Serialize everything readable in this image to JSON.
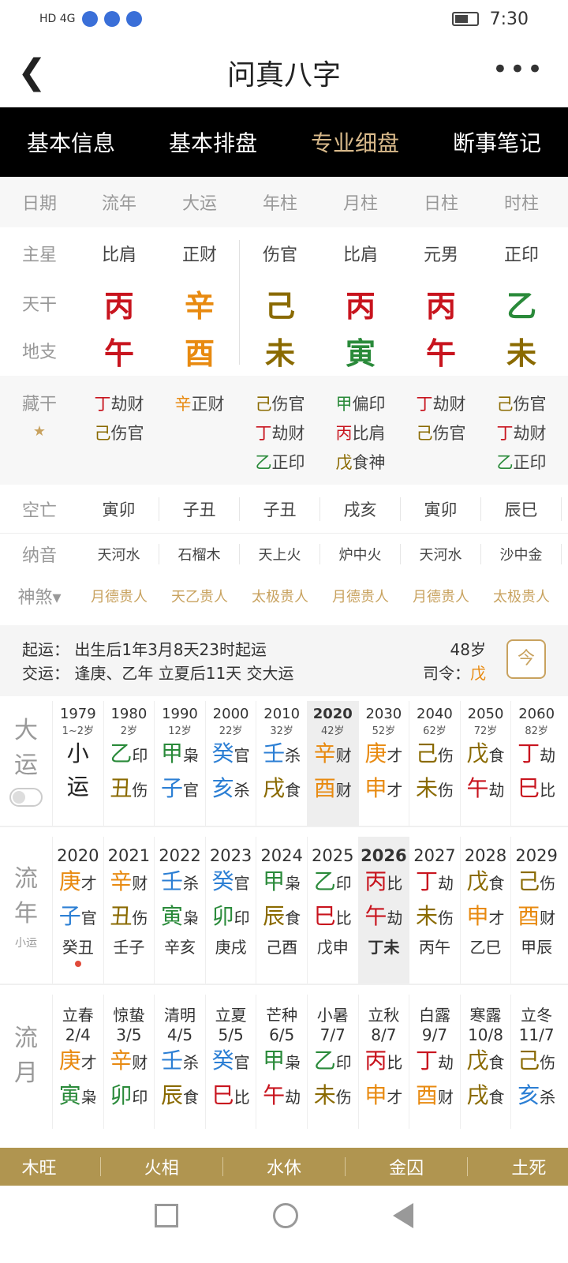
{
  "status": {
    "sig": "HD 4G",
    "time": "7:30"
  },
  "title": "问真八字",
  "tabs": [
    "基本信息",
    "基本排盘",
    "专业细盘",
    "断事笔记"
  ],
  "header": [
    "日期",
    "流年",
    "大运",
    "年柱",
    "月柱",
    "日柱",
    "时柱"
  ],
  "labels": {
    "zhuxing": "主星",
    "tiangan": "天干",
    "dizhi": "地支",
    "canggan": "藏干",
    "kongwang": "空亡",
    "nayin": "纳音",
    "shensha": "神煞"
  },
  "pillars": [
    {
      "star": "比肩",
      "gan": "丙",
      "zhi": "午",
      "gc": "red",
      "zc": "red"
    },
    {
      "star": "正财",
      "gan": "辛",
      "zhi": "酉",
      "gc": "org",
      "zc": "org"
    },
    {
      "star": "伤官",
      "gan": "己",
      "zhi": "未",
      "gc": "olv",
      "zc": "olv"
    },
    {
      "star": "比肩",
      "gan": "丙",
      "zhi": "寅",
      "gc": "red",
      "zc": "grn"
    },
    {
      "star": "元男",
      "gan": "丙",
      "zhi": "午",
      "gc": "red",
      "zc": "red"
    },
    {
      "star": "正印",
      "gan": "乙",
      "zhi": "未",
      "gc": "grn",
      "zc": "olv"
    }
  ],
  "canggan": [
    [
      "丁劫财",
      "己伤官"
    ],
    [
      "辛正财"
    ],
    [
      "己伤官",
      "丁劫财",
      "乙正印"
    ],
    [
      "甲偏印",
      "丙比肩",
      "戊食神"
    ],
    [
      "丁劫财",
      "己伤官"
    ],
    [
      "己伤官",
      "丁劫财",
      "乙正印"
    ]
  ],
  "kongwang": [
    "寅卯",
    "子丑",
    "子丑",
    "戌亥",
    "寅卯",
    "辰巳"
  ],
  "nayin": [
    "天河水",
    "石榴木",
    "天上火",
    "炉中火",
    "天河水",
    "沙中金"
  ],
  "shensha": [
    "月德贵人",
    "天乙贵人",
    "太极贵人",
    "月德贵人",
    "月德贵人",
    "太极贵人"
  ],
  "qiyun": {
    "line1": "起运： 出生后1年3月8天23时起运",
    "line2": "交运： 逢庚、乙年 立夏后11天 交大运",
    "age": "48岁",
    "siling": "司令：",
    "siling_val": "戊",
    "cal": "今"
  },
  "dayun": {
    "label1": "大",
    "label2": "运",
    "cols": [
      {
        "y": "1979",
        "a": "1~2岁",
        "g1": "小",
        "g2": "运"
      },
      {
        "y": "1980",
        "a": "2岁",
        "g1": "乙",
        "s1": "印",
        "g2": "丑",
        "s2": "伤"
      },
      {
        "y": "1990",
        "a": "12岁",
        "g1": "甲",
        "s1": "枭",
        "g2": "子",
        "s2": "官"
      },
      {
        "y": "2000",
        "a": "22岁",
        "g1": "癸",
        "s1": "官",
        "g2": "亥",
        "s2": "杀"
      },
      {
        "y": "2010",
        "a": "32岁",
        "g1": "壬",
        "s1": "杀",
        "g2": "戌",
        "s2": "食"
      },
      {
        "y": "2020",
        "a": "42岁",
        "g1": "辛",
        "s1": "财",
        "g2": "酉",
        "s2": "财"
      },
      {
        "y": "2030",
        "a": "52岁",
        "g1": "庚",
        "s1": "才",
        "g2": "申",
        "s2": "才"
      },
      {
        "y": "2040",
        "a": "62岁",
        "g1": "己",
        "s1": "伤",
        "g2": "未",
        "s2": "伤"
      },
      {
        "y": "2050",
        "a": "72岁",
        "g1": "戊",
        "s1": "食",
        "g2": "午",
        "s2": "劫"
      },
      {
        "y": "2060",
        "a": "82岁",
        "g1": "丁",
        "s1": "劫",
        "g2": "巳",
        "s2": "比"
      }
    ]
  },
  "liunian": {
    "label1": "流",
    "label2": "年",
    "small": "小运",
    "cols": [
      {
        "y": "2020",
        "g1": "庚",
        "s1": "才",
        "g2": "子",
        "s2": "官",
        "x": "癸丑"
      },
      {
        "y": "2021",
        "g1": "辛",
        "s1": "财",
        "g2": "丑",
        "s2": "伤",
        "x": "壬子"
      },
      {
        "y": "2022",
        "g1": "壬",
        "s1": "杀",
        "g2": "寅",
        "s2": "枭",
        "x": "辛亥"
      },
      {
        "y": "2023",
        "g1": "癸",
        "s1": "官",
        "g2": "卯",
        "s2": "印",
        "x": "庚戌"
      },
      {
        "y": "2024",
        "g1": "甲",
        "s1": "枭",
        "g2": "辰",
        "s2": "食",
        "x": "己酉"
      },
      {
        "y": "2025",
        "g1": "乙",
        "s1": "印",
        "g2": "巳",
        "s2": "比",
        "x": "戊申"
      },
      {
        "y": "2026",
        "g1": "丙",
        "s1": "比",
        "g2": "午",
        "s2": "劫",
        "x": "丁未"
      },
      {
        "y": "2027",
        "g1": "丁",
        "s1": "劫",
        "g2": "未",
        "s2": "伤",
        "x": "丙午"
      },
      {
        "y": "2028",
        "g1": "戊",
        "s1": "食",
        "g2": "申",
        "s2": "才",
        "x": "乙巳"
      },
      {
        "y": "2029",
        "g1": "己",
        "s1": "伤",
        "g2": "酉",
        "s2": "财",
        "x": "甲辰"
      }
    ]
  },
  "liuyue": {
    "label1": "流",
    "label2": "月",
    "cols": [
      {
        "t": "立春",
        "d": "2/4",
        "g1": "庚",
        "s1": "才",
        "g2": "寅",
        "s2": "枭"
      },
      {
        "t": "惊蛰",
        "d": "3/5",
        "g1": "辛",
        "s1": "财",
        "g2": "卯",
        "s2": "印"
      },
      {
        "t": "清明",
        "d": "4/5",
        "g1": "壬",
        "s1": "杀",
        "g2": "辰",
        "s2": "食"
      },
      {
        "t": "立夏",
        "d": "5/5",
        "g1": "癸",
        "s1": "官",
        "g2": "巳",
        "s2": "比"
      },
      {
        "t": "芒种",
        "d": "6/5",
        "g1": "甲",
        "s1": "枭",
        "g2": "午",
        "s2": "劫"
      },
      {
        "t": "小暑",
        "d": "7/7",
        "g1": "乙",
        "s1": "印",
        "g2": "未",
        "s2": "伤"
      },
      {
        "t": "立秋",
        "d": "8/7",
        "g1": "丙",
        "s1": "比",
        "g2": "申",
        "s2": "才"
      },
      {
        "t": "白露",
        "d": "9/7",
        "g1": "丁",
        "s1": "劫",
        "g2": "酉",
        "s2": "财"
      },
      {
        "t": "寒露",
        "d": "10/8",
        "g1": "戊",
        "s1": "食",
        "g2": "戌",
        "s2": "食"
      },
      {
        "t": "立冬",
        "d": "11/7",
        "g1": "己",
        "s1": "伤",
        "g2": "亥",
        "s2": "杀"
      }
    ]
  },
  "footer": [
    "木旺",
    "火相",
    "水休",
    "金囚",
    "土死"
  ]
}
